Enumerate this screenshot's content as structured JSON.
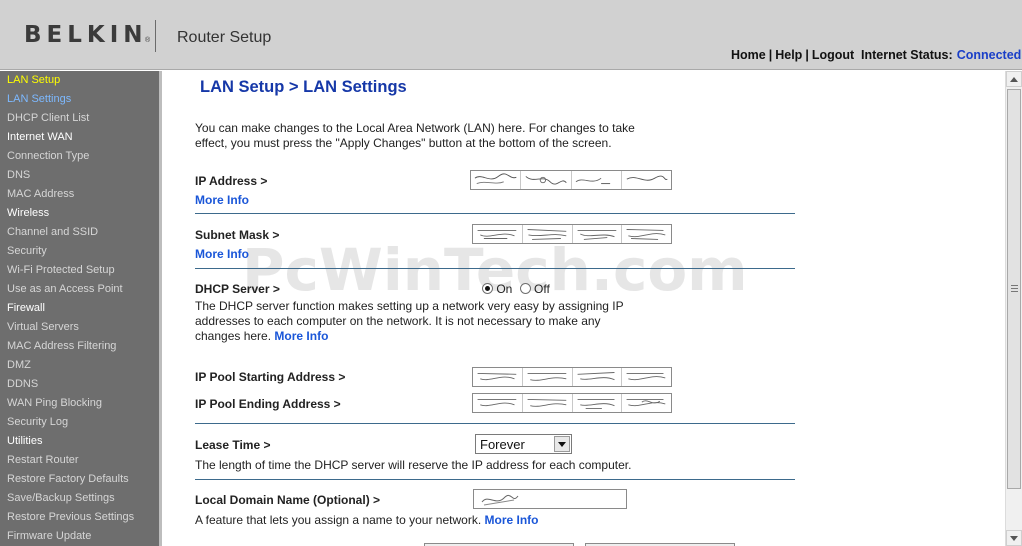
{
  "header": {
    "brand": "BELKIN",
    "brand_mark": "®",
    "title": "Router Setup",
    "nav": {
      "home": "Home",
      "help": "Help",
      "logout": "Logout",
      "separator": "|"
    },
    "internet_status_label": "Internet Status:",
    "internet_status_value": "Connected"
  },
  "sidebar": {
    "items": [
      {
        "label": "LAN Setup",
        "kind": "current-section"
      },
      {
        "label": "LAN Settings",
        "kind": "active"
      },
      {
        "label": "DHCP Client List",
        "kind": "item"
      },
      {
        "label": "Internet WAN",
        "kind": "section"
      },
      {
        "label": "Connection Type",
        "kind": "item"
      },
      {
        "label": "DNS",
        "kind": "item"
      },
      {
        "label": "MAC Address",
        "kind": "item"
      },
      {
        "label": "Wireless",
        "kind": "section"
      },
      {
        "label": "Channel and SSID",
        "kind": "item"
      },
      {
        "label": "Security",
        "kind": "item"
      },
      {
        "label": "Wi-Fi Protected Setup",
        "kind": "item"
      },
      {
        "label": "Use as an Access Point",
        "kind": "item"
      },
      {
        "label": "Firewall",
        "kind": "section"
      },
      {
        "label": "Virtual Servers",
        "kind": "item"
      },
      {
        "label": "MAC Address Filtering",
        "kind": "item"
      },
      {
        "label": "DMZ",
        "kind": "item"
      },
      {
        "label": "DDNS",
        "kind": "item"
      },
      {
        "label": "WAN Ping Blocking",
        "kind": "item"
      },
      {
        "label": "Security Log",
        "kind": "item"
      },
      {
        "label": "Utilities",
        "kind": "section"
      },
      {
        "label": "Restart Router",
        "kind": "item"
      },
      {
        "label": "Restore Factory Defaults",
        "kind": "item"
      },
      {
        "label": "Save/Backup Settings",
        "kind": "item"
      },
      {
        "label": "Restore Previous Settings",
        "kind": "item"
      },
      {
        "label": "Firmware Update",
        "kind": "item"
      }
    ]
  },
  "main": {
    "title": "LAN Setup > LAN Settings",
    "intro_line1": "You can make changes to the Local Area Network (LAN) here. For changes to take",
    "intro_line2": "effect, you must press the \"Apply Changes\" button at the bottom of the screen.",
    "ip_address_label": "IP Address >",
    "more_info": "More Info",
    "subnet_mask_label": "Subnet Mask >",
    "dhcp_server_label": "DHCP Server  >",
    "dhcp_on": "On",
    "dhcp_off": "Off",
    "dhcp_selected": "On",
    "dhcp_desc_line1": "The DHCP server function makes setting up a network very easy by assigning IP",
    "dhcp_desc_line2": "addresses to each computer on the network. It is not necessary to make any",
    "dhcp_desc_line3": "changes here.",
    "ip_pool_start_label": "IP Pool Starting Address >",
    "ip_pool_end_label": "IP Pool Ending Address >",
    "lease_time_label": "Lease Time >",
    "lease_time_value": "Forever",
    "lease_time_desc": "The length of time the DHCP server will reserve the IP address for each computer.",
    "domain_name_label": "Local Domain Name  (Optional) >",
    "domain_name_desc": "A feature that lets you assign a name to your network.",
    "watermark": "PcWinTech.com"
  }
}
